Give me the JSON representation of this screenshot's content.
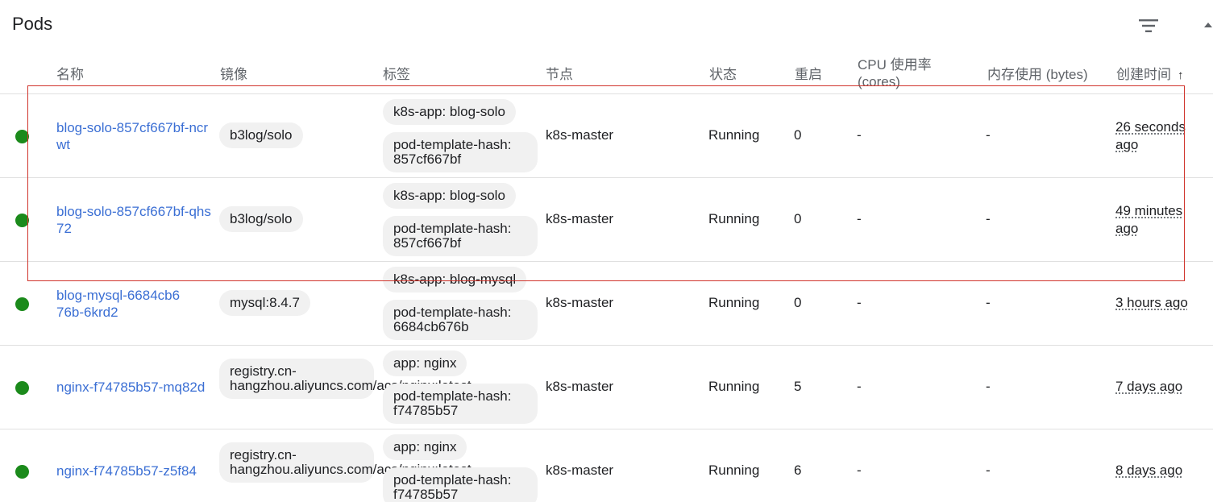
{
  "title": "Pods",
  "icons": {
    "filter": "filter-icon",
    "status": "status-running-icon",
    "sort": "arrow-upward-icon"
  },
  "colors": {
    "running": "#1b8a1b",
    "link": "#3b6fd4",
    "highlight": "#d0342c"
  },
  "headers": {
    "name": "名称",
    "image": "镜像",
    "labels": "标签",
    "node": "节点",
    "status": "状态",
    "restarts": "重启",
    "cpu": "CPU 使用率 (cores)",
    "memory": "内存使用 (bytes)",
    "created": "创建时间",
    "sort_arrow": "↑"
  },
  "rows": [
    {
      "name": "blog-solo-857cf667bf-ncrwt",
      "image": "b3log/solo",
      "labels": [
        "k8s-app: blog-solo",
        "pod-template-hash: 857cf667bf"
      ],
      "node": "k8s-master",
      "status": "Running",
      "restarts": "0",
      "cpu": "-",
      "memory": "-",
      "created": "26 seconds ago"
    },
    {
      "name": "blog-solo-857cf667bf-qhs72",
      "image": "b3log/solo",
      "labels": [
        "k8s-app: blog-solo",
        "pod-template-hash: 857cf667bf"
      ],
      "node": "k8s-master",
      "status": "Running",
      "restarts": "0",
      "cpu": "-",
      "memory": "-",
      "created": "49 minutes ago"
    },
    {
      "name": "blog-mysql-6684cb676b-6krd2",
      "image": "mysql:8.4.7",
      "labels": [
        "k8s-app: blog-mysql",
        "pod-template-hash: 6684cb676b"
      ],
      "node": "k8s-master",
      "status": "Running",
      "restarts": "0",
      "cpu": "-",
      "memory": "-",
      "created": "3 hours ago"
    },
    {
      "name": "nginx-f74785b57-mq82d",
      "image": "registry.cn-hangzhou.aliyuncs.com/acs/nginx:latest",
      "labels": [
        "app: nginx",
        "pod-template-hash: f74785b57"
      ],
      "node": "k8s-master",
      "status": "Running",
      "restarts": "5",
      "cpu": "-",
      "memory": "-",
      "created": "7 days ago"
    },
    {
      "name": "nginx-f74785b57-z5f84",
      "image": "registry.cn-hangzhou.aliyuncs.com/acs/nginx:latest",
      "labels": [
        "app: nginx",
        "pod-template-hash: f74785b57"
      ],
      "node": "k8s-master",
      "status": "Running",
      "restarts": "6",
      "cpu": "-",
      "memory": "-",
      "created": "8 days ago"
    }
  ]
}
